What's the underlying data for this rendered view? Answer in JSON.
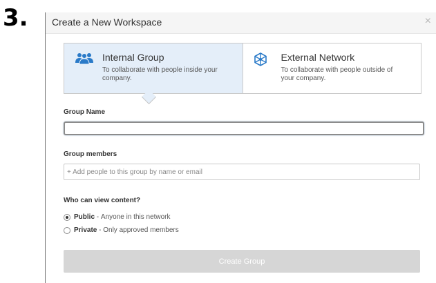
{
  "step_label": "3.",
  "dialog": {
    "title": "Create a New Workspace",
    "close_glyph": "×",
    "accent_color": "#2a7ac8",
    "active_tab_bg": "#e4eef9"
  },
  "type_tabs": [
    {
      "title": "Internal Group",
      "description": "To collaborate with people inside your company.",
      "icon": "people-icon",
      "active": true
    },
    {
      "title": "External Network",
      "description": "To collaborate with people outside of your company.",
      "icon": "network-icon",
      "active": false
    }
  ],
  "group_name": {
    "label": "Group Name",
    "value": ""
  },
  "group_members": {
    "label": "Group members",
    "placeholder": "+ Add people to this group by name or email"
  },
  "visibility": {
    "label": "Who can view content?",
    "options": [
      {
        "name": "Public",
        "separator": " - ",
        "description": "Anyone in this network",
        "selected": true
      },
      {
        "name": "Private",
        "separator": " - ",
        "description": "Only approved members",
        "selected": false
      }
    ]
  },
  "create_button": {
    "label": "Create Group",
    "disabled": true
  }
}
